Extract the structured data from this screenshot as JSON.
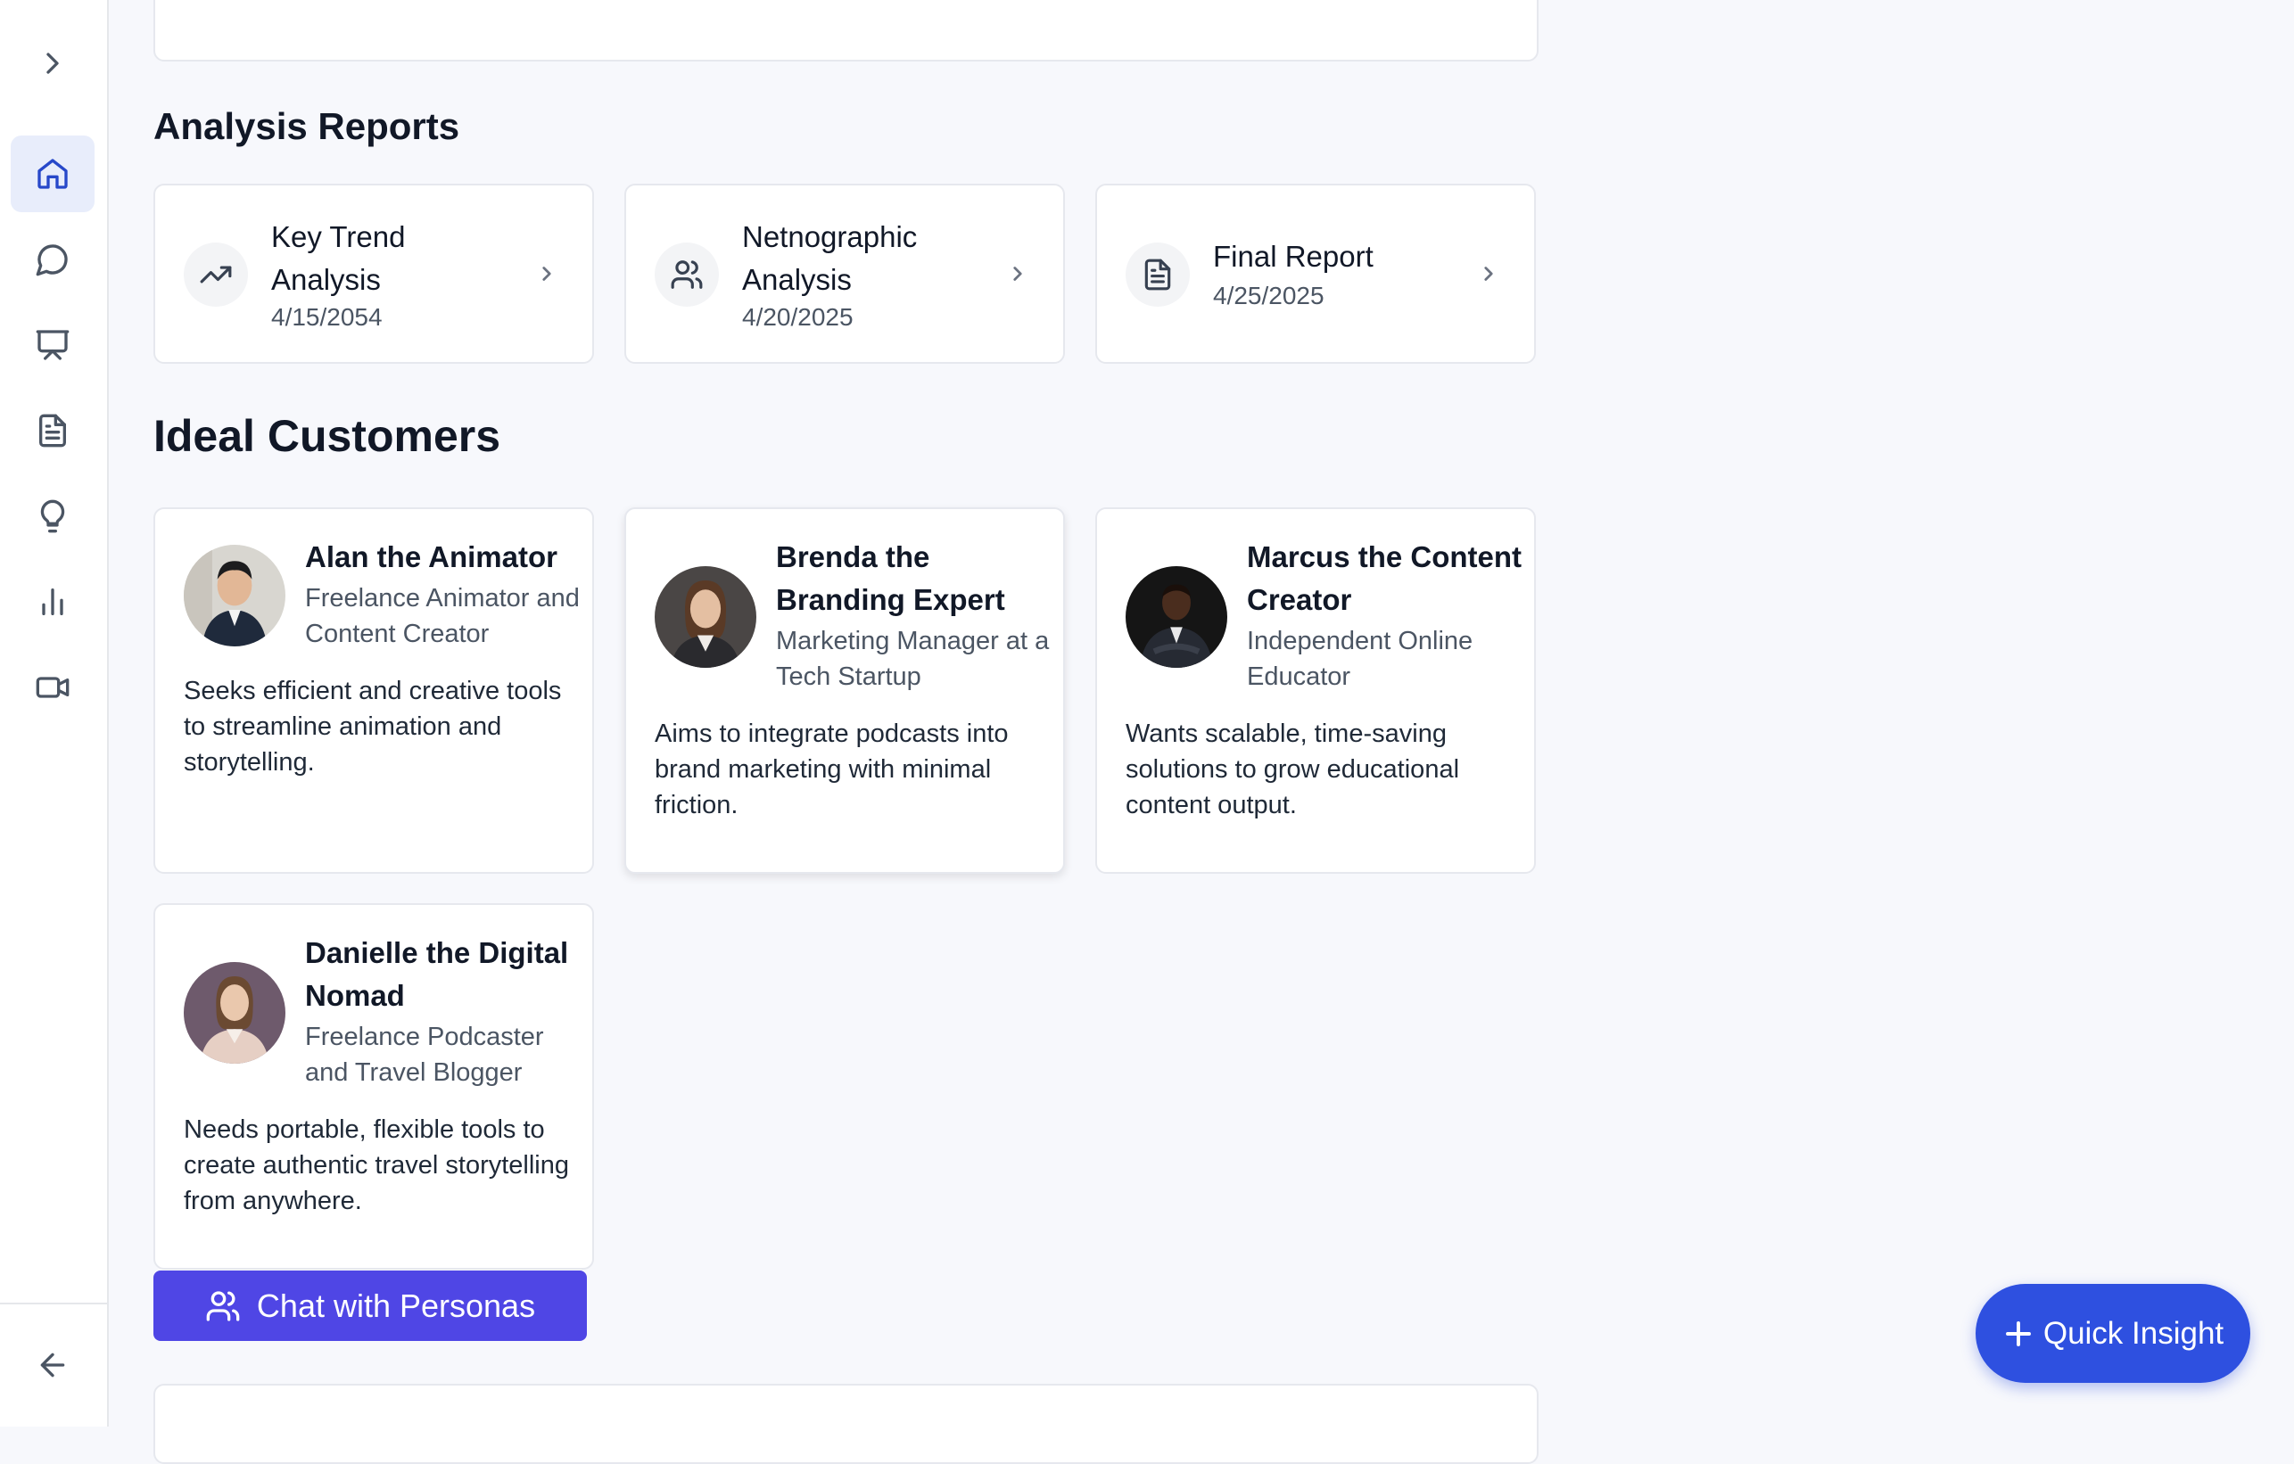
{
  "sidebar": {
    "items": [
      {
        "icon": "chevron-right-icon"
      },
      {
        "icon": "home-icon",
        "active": true
      },
      {
        "icon": "chat-bubble-icon"
      },
      {
        "icon": "presentation-icon"
      },
      {
        "icon": "document-icon"
      },
      {
        "icon": "lightbulb-icon"
      },
      {
        "icon": "bar-chart-icon"
      },
      {
        "icon": "video-camera-icon"
      },
      {
        "icon": "arrow-left-icon"
      }
    ]
  },
  "reports": {
    "title": "Analysis Reports",
    "items": [
      {
        "title": "Key Trend Analysis",
        "date": "4/15/2054",
        "icon": "trending-up-icon"
      },
      {
        "title": "Netnographic Analysis",
        "date": "4/20/2025",
        "icon": "users-icon"
      },
      {
        "title": "Final Report",
        "date": "4/25/2025",
        "icon": "document-icon"
      }
    ]
  },
  "customers": {
    "title": "Ideal Customers",
    "items": [
      {
        "name": "Alan the Animator",
        "role": "Freelance Animator and Content Creator",
        "desc": "Seeks efficient and creative tools to streamline animation and storytelling."
      },
      {
        "name": "Brenda the Branding Expert",
        "role": "Marketing Manager at a Tech Startup",
        "desc": "Aims to integrate podcasts into brand marketing with minimal friction."
      },
      {
        "name": "Marcus the Content Creator",
        "role": "Independent Online Educator",
        "desc": "Wants scalable, time-saving solutions to grow educational content output."
      },
      {
        "name": "Danielle the Digital Nomad",
        "role": "Freelance Podcaster and Travel Blogger",
        "desc": "Needs portable, flexible tools to create authentic travel storytelling from anywhere."
      }
    ]
  },
  "actions": {
    "chat_label": "Chat with Personas",
    "quick_label": "Quick Insight"
  },
  "colors": {
    "accent": "#2e50e0",
    "chat_button": "#4f46e5",
    "active_nav_bg": "#e8edfb"
  }
}
